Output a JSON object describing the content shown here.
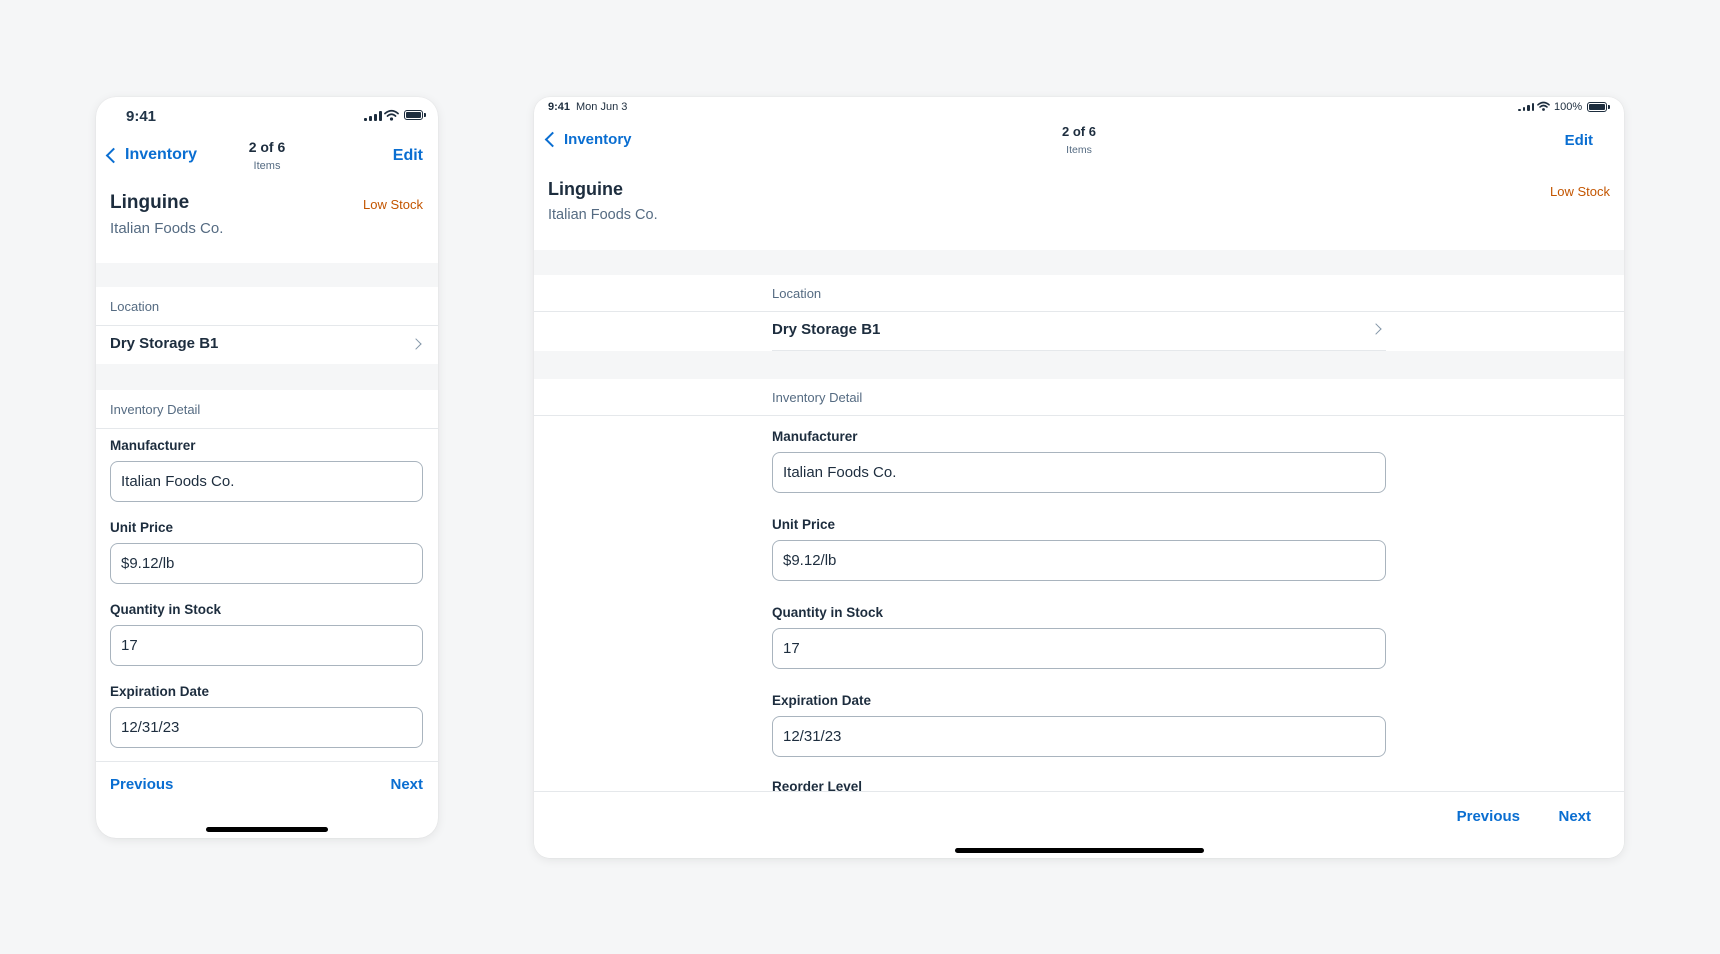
{
  "colors": {
    "accent": "#0a6ed1",
    "warning": "#c35500",
    "text_primary": "#1d2d3e",
    "text_secondary": "#556b82",
    "background": "#f5f6f7"
  },
  "phone": {
    "status": {
      "time": "9:41"
    },
    "nav": {
      "back_label": "Inventory",
      "title": "2 of 6",
      "subtitle": "Items",
      "edit_label": "Edit"
    },
    "object": {
      "title": "Linguine",
      "subtitle": "Italian Foods Co.",
      "status": "Low Stock"
    },
    "location": {
      "header": "Location",
      "value": "Dry Storage B1"
    },
    "detail": {
      "header": "Inventory Detail",
      "fields": [
        {
          "label": "Manufacturer",
          "value": "Italian Foods Co."
        },
        {
          "label": "Unit Price",
          "value": "$9.12/lb"
        },
        {
          "label": "Quantity in Stock",
          "value": "17"
        },
        {
          "label": "Expiration Date",
          "value": "12/31/23"
        }
      ]
    },
    "footer": {
      "previous": "Previous",
      "next": "Next"
    }
  },
  "tablet": {
    "status": {
      "time": "9:41",
      "date": "Mon Jun 3",
      "battery": "100%"
    },
    "nav": {
      "back_label": "Inventory",
      "title": "2 of 6",
      "subtitle": "Items",
      "edit_label": "Edit"
    },
    "object": {
      "title": "Linguine",
      "subtitle": "Italian Foods Co.",
      "status": "Low Stock"
    },
    "location": {
      "header": "Location",
      "value": "Dry Storage B1"
    },
    "detail": {
      "header": "Inventory Detail",
      "fields": [
        {
          "label": "Manufacturer",
          "value": "Italian Foods Co."
        },
        {
          "label": "Unit Price",
          "value": "$9.12/lb"
        },
        {
          "label": "Quantity in Stock",
          "value": "17"
        },
        {
          "label": "Expiration Date",
          "value": "12/31/23"
        }
      ],
      "next_label": "Reorder Level"
    },
    "footer": {
      "previous": "Previous",
      "next": "Next"
    }
  }
}
